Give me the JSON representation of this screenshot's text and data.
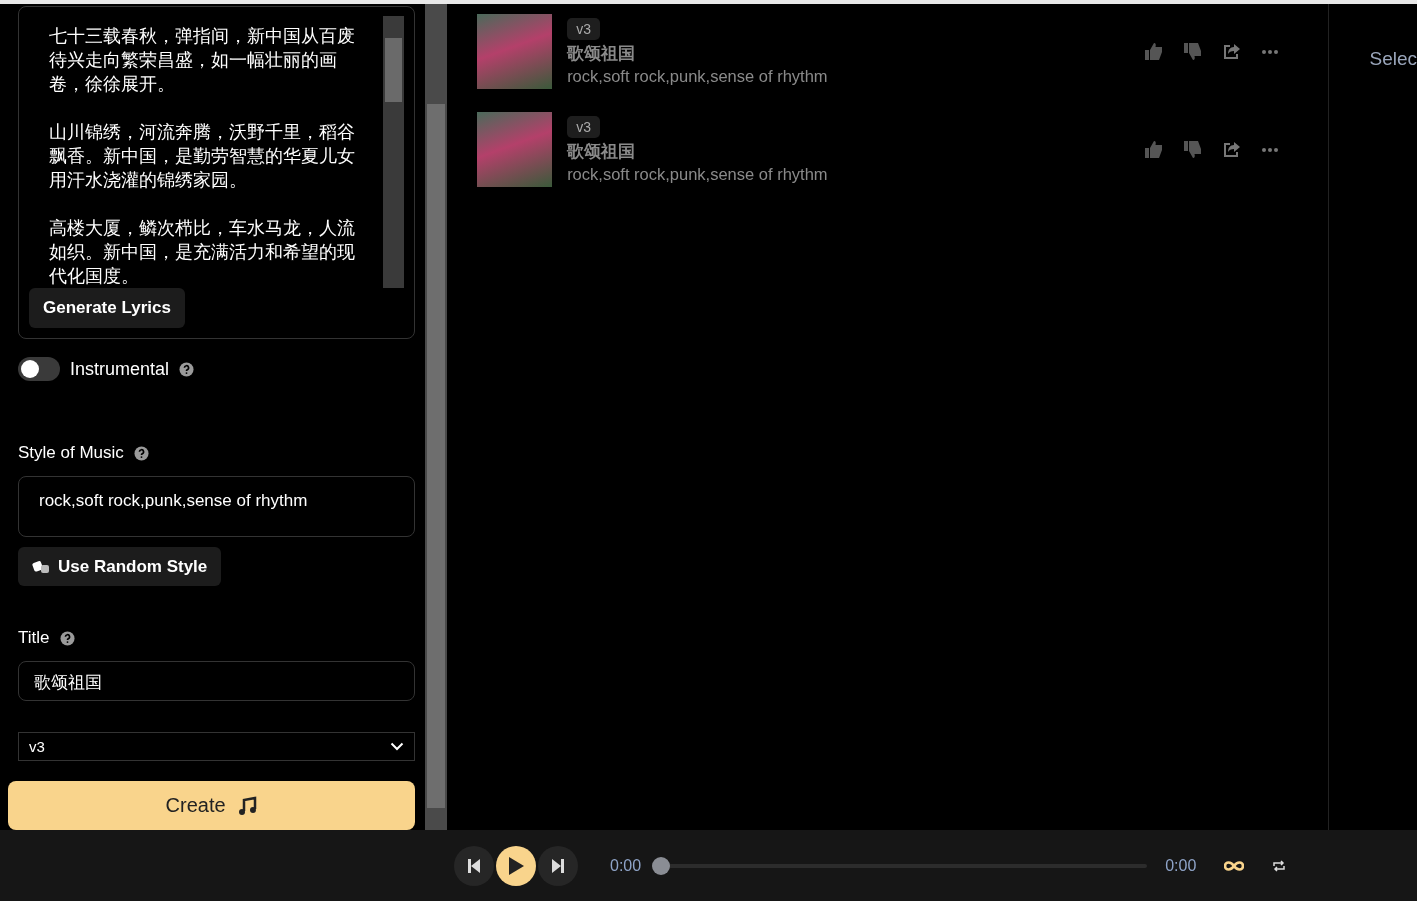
{
  "lyrics": {
    "paragraphs": [
      "七十三载春秋，弹指间，新中国从百废待兴走向繁荣昌盛，如一幅壮丽的画卷，徐徐展开。",
      "山川锦绣，河流奔腾，沃野千里，稻谷飘香。新中国，是勤劳智慧的华夏儿女用汗水浇灌的锦绣家园。",
      "高楼大厦，鳞次栉比，车水马龙，人流如织。新中国，是充满活力和希望的现代化国度。"
    ]
  },
  "generate_lyrics_button": "Generate Lyrics",
  "instrumental": {
    "label": "Instrumental",
    "on": false
  },
  "style_of_music": {
    "label": "Style of Music",
    "value": "rock,soft rock,punk,sense of rhythm"
  },
  "random_style_button": "Use Random Style",
  "title_field": {
    "label": "Title",
    "value": "歌颂祖国"
  },
  "model_select": {
    "value": "v3"
  },
  "create_button": "Create",
  "songs": [
    {
      "version": "v3",
      "title": "歌颂祖国",
      "style": "rock,soft rock,punk,sense of rhythm"
    },
    {
      "version": "v3",
      "title": "歌颂祖国",
      "style": "rock,soft rock,punk,sense of rhythm"
    }
  ],
  "right_panel": {
    "text": "Selec"
  },
  "player": {
    "elapsed": "0:00",
    "duration": "0:00",
    "level": 0
  }
}
